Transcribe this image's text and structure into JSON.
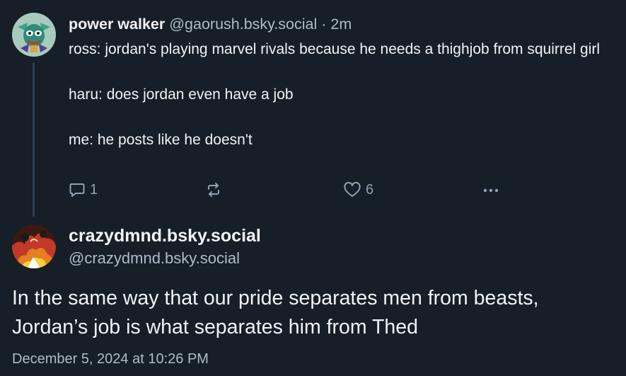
{
  "reply_post": {
    "display_name": "power walker",
    "handle": "@gaorush.bsky.social",
    "separator": "·",
    "time_ago": "2m",
    "body_lines": [
      "ross: jordan's playing marvel rivals because he needs a thighjob from squirrel girl",
      "haru: does jordan even have a job",
      "me: he posts like he doesn't"
    ],
    "reply_count": "1",
    "repost_count": "",
    "like_count": "6",
    "avatar_icon": "cartoon-character-avatar"
  },
  "main_post": {
    "display_name": "crazydmnd.bsky.social",
    "handle": "@crazydmnd.bsky.social",
    "body_lines": [
      "In the same way that our pride separates men from beasts,",
      "Jordan’s job is what separates him from Thed"
    ],
    "timestamp": "December 5, 2024 at 10:26 PM",
    "avatar_icon": "fiery-artwork-avatar"
  },
  "icons": {
    "reply": "speech-bubble-icon",
    "repost": "repost-arrows-icon",
    "like": "heart-icon",
    "more": "ellipsis-icon"
  },
  "colors": {
    "background": "#161e27",
    "text_primary": "#f1f3f5",
    "text_secondary": "#aebbc9",
    "action_icon": "#8fa2b6",
    "thread_line": "#2e4052"
  }
}
